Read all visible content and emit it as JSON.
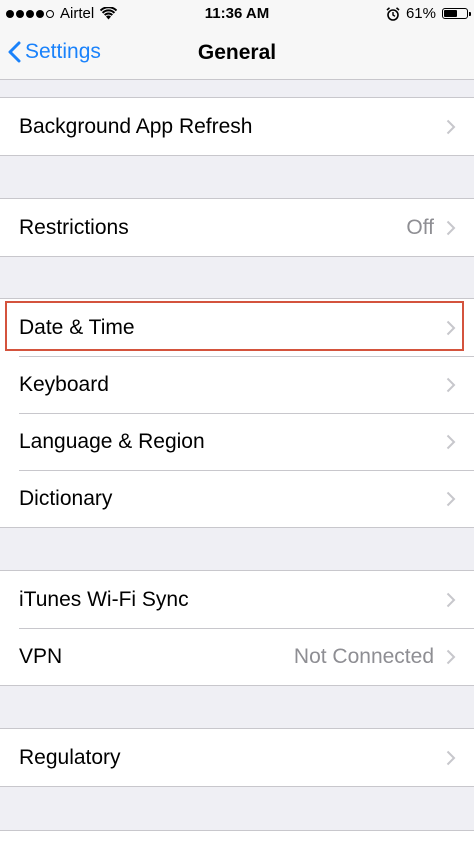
{
  "status": {
    "carrier": "Airtel",
    "time": "11:36 AM",
    "battery": "61%",
    "battery_level": 0.61,
    "icons": [
      "signal-dots",
      "wifi-icon",
      "alarm-icon",
      "battery-icon"
    ]
  },
  "nav": {
    "back_label": "Settings",
    "title": "General"
  },
  "groups": [
    {
      "rows": [
        {
          "label": "Background App Refresh",
          "value": ""
        }
      ]
    },
    {
      "rows": [
        {
          "label": "Restrictions",
          "value": "Off"
        }
      ]
    },
    {
      "rows": [
        {
          "label": "Date & Time",
          "value": ""
        },
        {
          "label": "Keyboard",
          "value": ""
        },
        {
          "label": "Language & Region",
          "value": ""
        },
        {
          "label": "Dictionary",
          "value": ""
        }
      ]
    },
    {
      "rows": [
        {
          "label": "iTunes Wi-Fi Sync",
          "value": ""
        },
        {
          "label": "VPN",
          "value": "Not Connected"
        }
      ]
    },
    {
      "rows": [
        {
          "label": "Regulatory",
          "value": ""
        }
      ]
    }
  ],
  "colors": {
    "accent": "#1a82fb",
    "highlight": "#d4533d",
    "background": "#efeff4",
    "separator": "#c8c7cc",
    "secondary_text": "#8e8e93"
  }
}
